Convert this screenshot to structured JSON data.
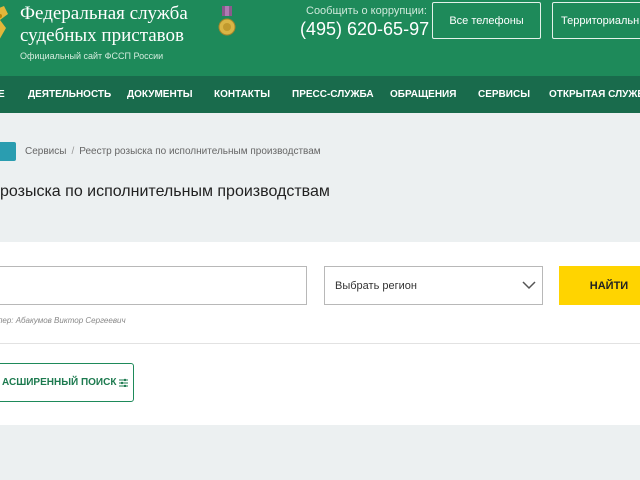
{
  "header": {
    "org_title_line1": "Федеральная служба",
    "org_title_line2": "судебных приставов",
    "org_subtitle": "Официальный сайт ФССП России",
    "corruption_label": "Сообщить о коррупции:",
    "corruption_phone": "(495) 620-65-97",
    "all_phones_label": "Все телефоны",
    "territorial_label": "Территориальные"
  },
  "nav": {
    "items": [
      {
        "label": "Е"
      },
      {
        "label": "ДЕЯТЕЛЬНОСТЬ"
      },
      {
        "label": "ДОКУМЕНТЫ"
      },
      {
        "label": "КОНТАКТЫ"
      },
      {
        "label": "ПРЕСС-СЛУЖБА"
      },
      {
        "label": "ОБРАЩЕНИЯ"
      },
      {
        "label": "СЕРВИСЫ"
      },
      {
        "label": "ОТКРЫТАЯ СЛУЖБА"
      }
    ]
  },
  "breadcrumb": {
    "separator": "/",
    "items": [
      {
        "label": "Сервисы"
      },
      {
        "label": "Реестр розыска по исполнительным производствам"
      }
    ]
  },
  "page": {
    "title": "розыска по исполнительным производствам"
  },
  "search": {
    "input_value": "",
    "region_selected": "Выбрать регион",
    "find_label": "НАЙТИ",
    "hint": "пер: Абакумов Виктор Сергеевич",
    "advanced_label": "АСШИРЕННЫЙ ПОИСК"
  },
  "colors": {
    "header_green": "#1e8a5a",
    "nav_green": "#196b4c",
    "find_yellow": "#ffd400",
    "home_teal": "#2a9db0"
  },
  "icons": {
    "emblem": "eagle-emblem-icon",
    "medal": "medal-icon",
    "home": "home-icon",
    "dropdown": "chevron-down-icon",
    "filter": "filter-icon"
  }
}
